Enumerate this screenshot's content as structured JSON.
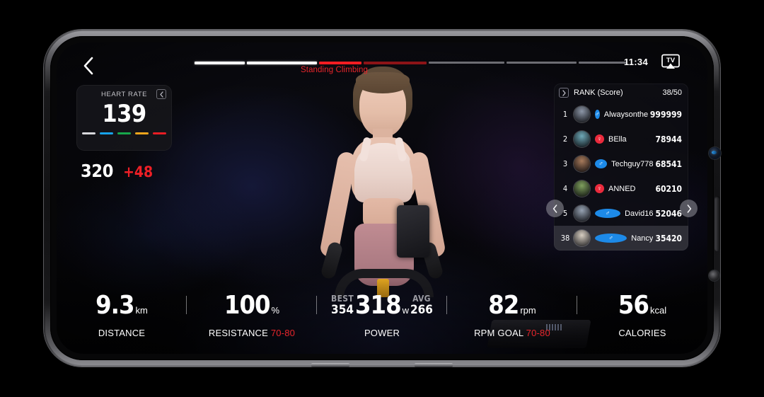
{
  "topbar": {
    "back_icon": "chevron-left-icon",
    "clock": "11:34",
    "cast_icon": "tv-cast-icon",
    "cast_label": "TV",
    "segment_label": "Standing Climbing",
    "segments": [
      {
        "name": "warmup",
        "width": 72,
        "color": "#ffffff"
      },
      {
        "name": "seated-flat",
        "width": 100,
        "color": "#ffffff"
      },
      {
        "name": "standing-climbing-active",
        "width": 60,
        "color": "#f21d22"
      },
      {
        "name": "standing-climbing-remaining",
        "width": 90,
        "color": "#8c1317"
      },
      {
        "name": "upcoming-1",
        "width": 108,
        "color": "#6d6d73"
      },
      {
        "name": "upcoming-2",
        "width": 100,
        "color": "#6d6d73"
      },
      {
        "name": "upcoming-3",
        "width": 68,
        "color": "#6d6d73"
      }
    ]
  },
  "heart_rate": {
    "title": "HEART RATE",
    "value": "139",
    "collapse_icon": "chevron-left-icon",
    "zones": [
      "#d8d8dc",
      "#17a2e8",
      "#17a64a",
      "#f0a51c",
      "#e81d24"
    ]
  },
  "score": {
    "value": "320",
    "delta": "+48"
  },
  "rank": {
    "expand_icon": "chevron-right-icon",
    "title": "RANK (Score)",
    "count": "38/50",
    "prev_icon": "chevron-left-icon",
    "next_icon": "chevron-right-icon",
    "rows": [
      {
        "pos": "1",
        "name": "Alwaysonthego",
        "score": "999999",
        "gender": "m",
        "avatar": "#8d97a8",
        "me": false
      },
      {
        "pos": "2",
        "name": "BElla",
        "score": "78944",
        "gender": "f",
        "avatar": "#6fa9b8",
        "me": false
      },
      {
        "pos": "3",
        "name": "Techguy778",
        "score": "68541",
        "gender": "m",
        "avatar": "#a87b5c",
        "me": false
      },
      {
        "pos": "4",
        "name": "ANNED",
        "score": "60210",
        "gender": "f",
        "avatar": "#7fa05e",
        "me": false
      },
      {
        "pos": "5",
        "name": "David16",
        "score": "52046",
        "gender": "m",
        "avatar": "#97a3b3",
        "me": false
      },
      {
        "pos": "38",
        "name": "Nancy",
        "score": "35420",
        "gender": "m",
        "avatar": "#d8cfc2",
        "me": true
      }
    ]
  },
  "metrics": [
    {
      "name": "distance",
      "value": "9.3",
      "unit": "km",
      "caption": "DISTANCE",
      "goal": "",
      "best": "",
      "best_label": "",
      "avg": "",
      "avg_label": ""
    },
    {
      "name": "resistance",
      "value": "100",
      "unit": "%",
      "caption": "RESISTANCE",
      "goal": "70-80",
      "best": "",
      "best_label": "",
      "avg": "",
      "avg_label": ""
    },
    {
      "name": "power",
      "value": "318",
      "unit": "w",
      "caption": "POWER",
      "goal": "",
      "best": "354",
      "best_label": "BEST",
      "avg": "266",
      "avg_label": "AVG"
    },
    {
      "name": "rpm",
      "value": "82",
      "unit": "rpm",
      "caption": "RPM GOAL",
      "goal": "70-80",
      "best": "",
      "best_label": "",
      "avg": "",
      "avg_label": ""
    },
    {
      "name": "calories",
      "value": "56",
      "unit": "kcal",
      "caption": "CALORIES",
      "goal": "",
      "best": "",
      "best_label": "",
      "avg": "",
      "avg_label": ""
    }
  ]
}
